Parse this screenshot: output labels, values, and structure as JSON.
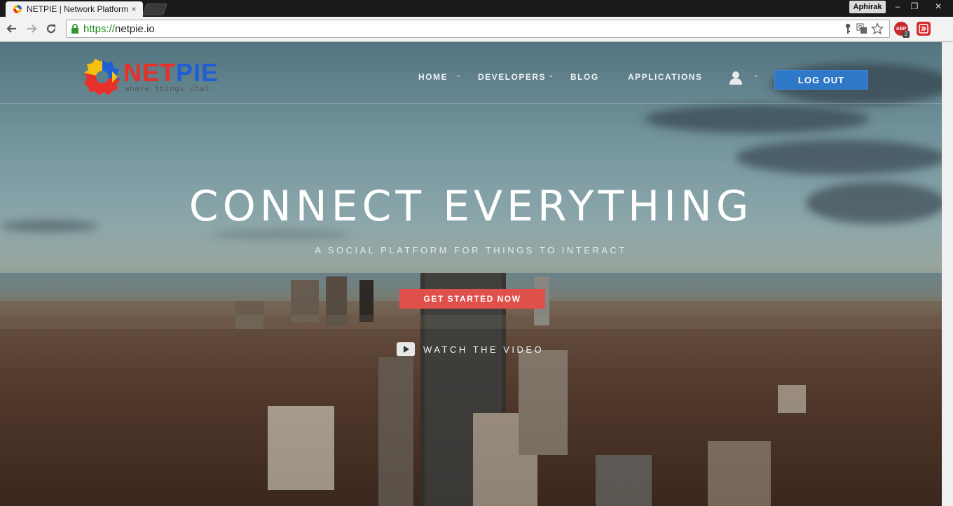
{
  "browser": {
    "tab_title": "NETPIE | Network Platform",
    "tab_close": "×",
    "profile_name": "Aphirak",
    "window_controls": {
      "minimize": "–",
      "restore": "❐",
      "close": "✕"
    },
    "url_scheme": "https://",
    "url_host": "netpie.io",
    "extensions": [
      {
        "name": "adblock-plus-icon",
        "label": "ABP",
        "badge": "2",
        "color": "#c8282c"
      },
      {
        "name": "extension-icon",
        "label": "",
        "color": "#d8282c"
      }
    ]
  },
  "navbar": {
    "logo_text_red": "NET",
    "logo_text_blue": "PIE",
    "logo_tagline": "where things chat",
    "items": [
      {
        "label": "HOME",
        "has_dropdown": true
      },
      {
        "label": "DEVELOPERS",
        "has_dropdown": true
      },
      {
        "label": "BLOG",
        "has_dropdown": false
      },
      {
        "label": "APPLICATIONS",
        "has_dropdown": false
      }
    ],
    "caret": "⌄",
    "logout_label": "LOG OUT"
  },
  "hero": {
    "title": "CONNECT EVERYTHING",
    "subtitle": "A SOCIAL PLATFORM FOR THINGS TO INTERACT",
    "cta_label": "GET STARTED NOW",
    "video_label": "WATCH THE VIDEO"
  },
  "colors": {
    "cta": "#e0504b",
    "logout": "#2f78c8",
    "brand_red": "#e8302a",
    "brand_blue": "#1e5fd6"
  }
}
